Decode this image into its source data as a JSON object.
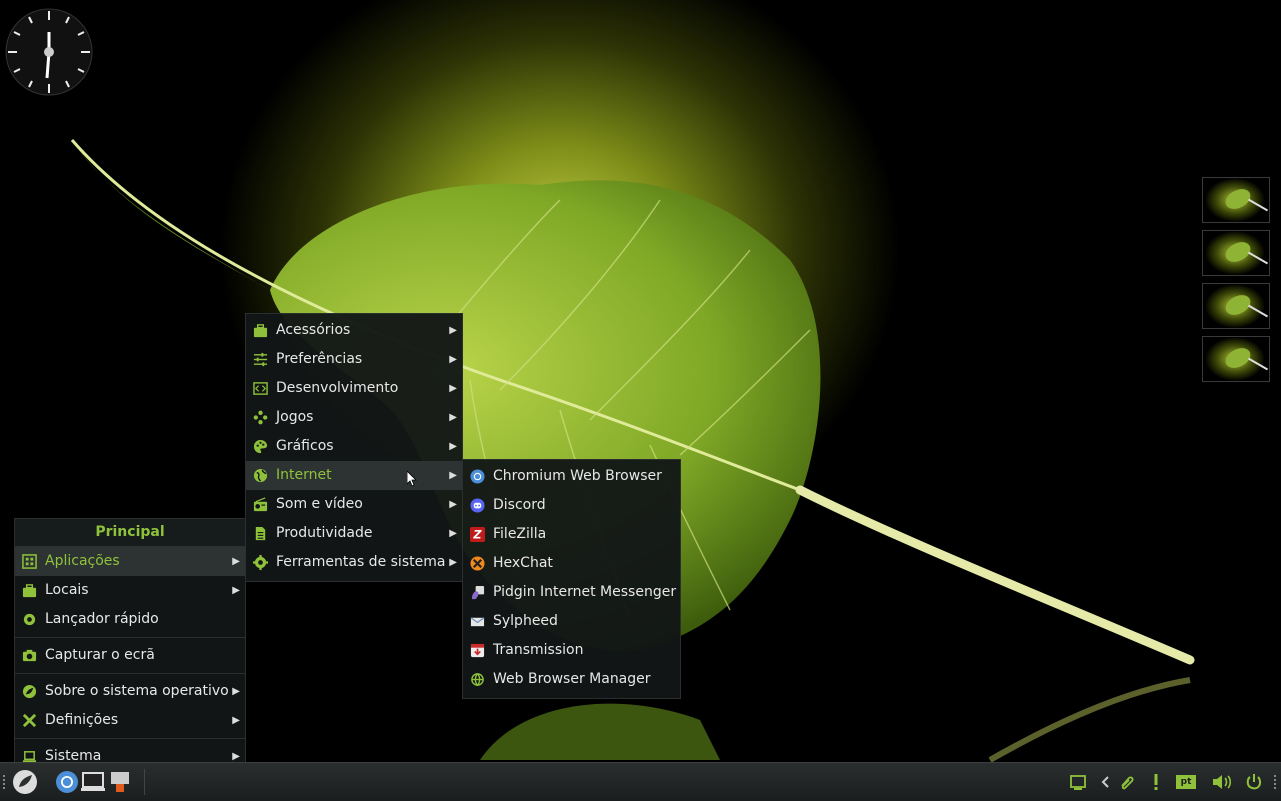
{
  "desktop": {
    "workspace_count": 4
  },
  "principal_menu": {
    "title": "Principal",
    "items": [
      {
        "label": "Aplicações",
        "icon": "grid-icon",
        "submenu": true,
        "active": true
      },
      {
        "label": "Locais",
        "icon": "briefcase-icon",
        "submenu": true
      },
      {
        "label": "Lançador rápido",
        "icon": "gear-icon",
        "submenu": false
      },
      {
        "label": "Capturar o ecrã",
        "icon": "camera-icon",
        "submenu": false
      },
      {
        "label": "Sobre o sistema operativo",
        "icon": "leaf-logo-icon",
        "submenu": true
      },
      {
        "label": "Definições",
        "icon": "tools-icon",
        "submenu": true
      },
      {
        "label": "Sistema",
        "icon": "laptop-icon",
        "submenu": true
      }
    ]
  },
  "applications_menu": {
    "items": [
      {
        "label": "Acessórios",
        "icon": "briefcase-icon"
      },
      {
        "label": "Preferências",
        "icon": "sliders-icon"
      },
      {
        "label": "Desenvolvimento",
        "icon": "code-icon"
      },
      {
        "label": "Jogos",
        "icon": "gamepad-icon"
      },
      {
        "label": "Gráficos",
        "icon": "palette-icon"
      },
      {
        "label": "Internet",
        "icon": "globe-icon",
        "active": true
      },
      {
        "label": "Som e vídeo",
        "icon": "radio-icon"
      },
      {
        "label": "Produtividade",
        "icon": "document-icon"
      },
      {
        "label": "Ferramentas de sistema",
        "icon": "gear-icon"
      }
    ]
  },
  "internet_menu": {
    "items": [
      {
        "label": "Chromium Web Browser",
        "icon": "chromium-icon"
      },
      {
        "label": "Discord",
        "icon": "discord-icon"
      },
      {
        "label": "FileZilla",
        "icon": "filezilla-icon"
      },
      {
        "label": "HexChat",
        "icon": "hexchat-icon"
      },
      {
        "label": "Pidgin Internet Messenger",
        "icon": "pidgin-icon"
      },
      {
        "label": "Sylpheed",
        "icon": "sylpheed-icon"
      },
      {
        "label": "Transmission",
        "icon": "transmission-icon"
      },
      {
        "label": "Web Browser Manager",
        "icon": "web-browser-manager-icon"
      }
    ]
  },
  "taskbar": {
    "launchers": [
      "menu-logo-icon",
      "chromium-icon",
      "terminal-icon",
      "text-editor-icon"
    ],
    "tray": [
      "window-icon",
      "chevron-left-icon",
      "paperclip-icon",
      "exclamation-icon",
      "keyboard-layout-icon",
      "volume-icon",
      "power-icon"
    ],
    "keyboard_layout": "pt"
  },
  "colors": {
    "accent": "#8fc23a",
    "menu_bg": "#121616",
    "active_bg": "#2d3333"
  }
}
